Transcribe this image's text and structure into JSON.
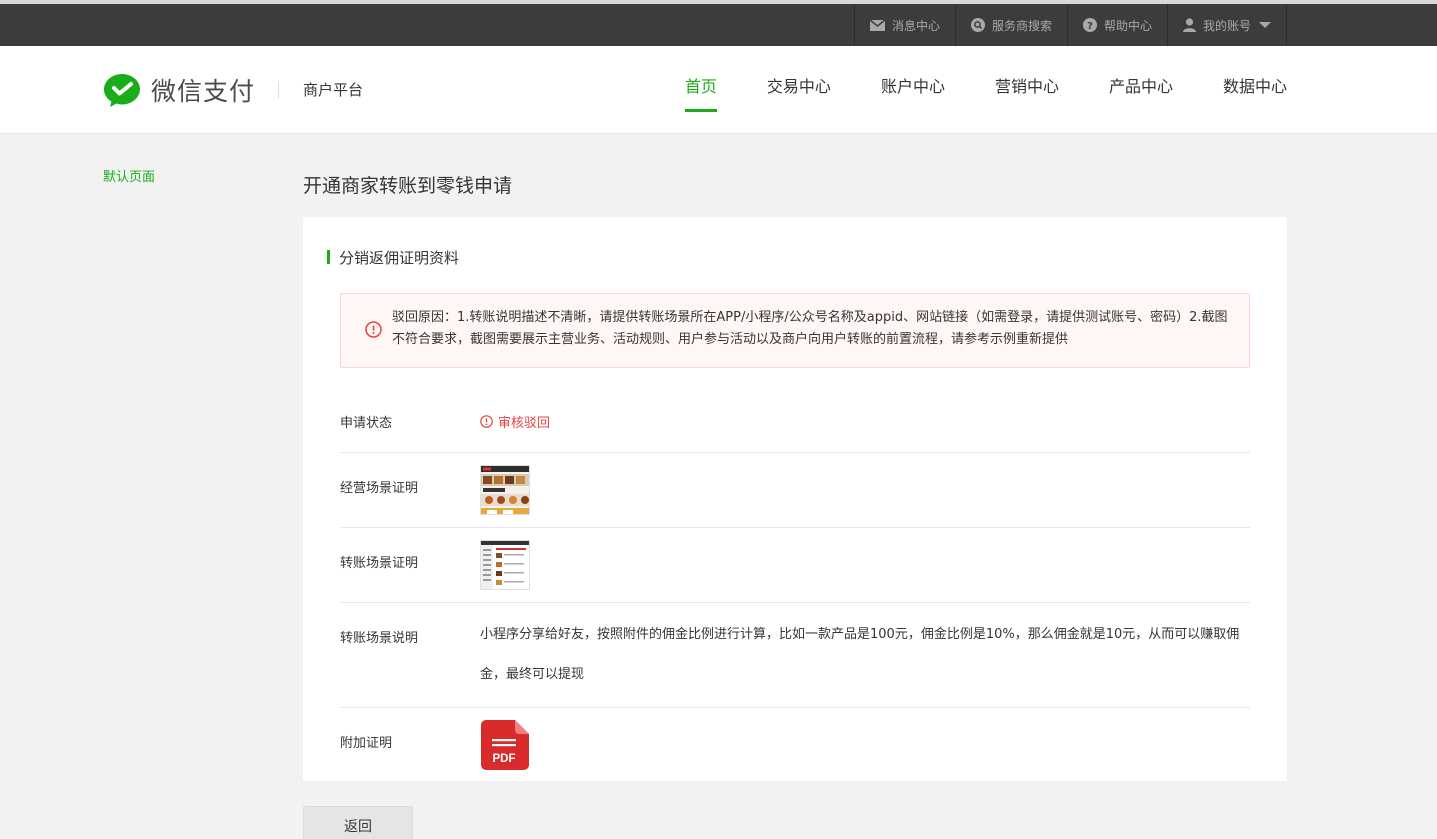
{
  "topbar": {
    "items": [
      {
        "label": "消息中心",
        "icon": "mail-icon"
      },
      {
        "label": "服务商搜索",
        "icon": "search-icon"
      },
      {
        "label": "帮助中心",
        "icon": "help-icon"
      },
      {
        "label": "我的账号",
        "icon": "user-icon"
      }
    ]
  },
  "header": {
    "brand": "微信支付",
    "platform": "商户平台",
    "nav": [
      "首页",
      "交易中心",
      "账户中心",
      "营销中心",
      "产品中心",
      "数据中心"
    ],
    "active_nav": "首页"
  },
  "sidebar": {
    "link": "默认页面"
  },
  "page": {
    "title": "开通商家转账到零钱申请",
    "section_title": "分销返佣证明资料",
    "alert": "驳回原因：1.转账说明描述不清晰，请提供转账场景所在APP/小程序/公众号名称及appid、网站链接（如需登录，请提供测试账号、密码）2.截图不符合要求，截图需要展示主营业务、活动规则、用户参与活动以及商户向用户转账的前置流程，请参考示例重新提供",
    "rows": {
      "status_label": "申请状态",
      "status_value": "审核驳回",
      "scene_proof_label": "经营场景证明",
      "transfer_proof_label": "转账场景证明",
      "transfer_desc_label": "转账场景说明",
      "transfer_desc_value": "小程序分享给好友，按照附件的佣金比例进行计算，比如一款产品是100元，佣金比例是10%，那么佣金就是10元，从而可以赚取佣金，最终可以提现",
      "extra_label": "附加证明",
      "pdf_text": "PDF"
    },
    "back_button": "返回"
  },
  "colors": {
    "brand_green": "#1aad19",
    "error_red": "#e64340",
    "topbar": "#3b3c3e"
  }
}
